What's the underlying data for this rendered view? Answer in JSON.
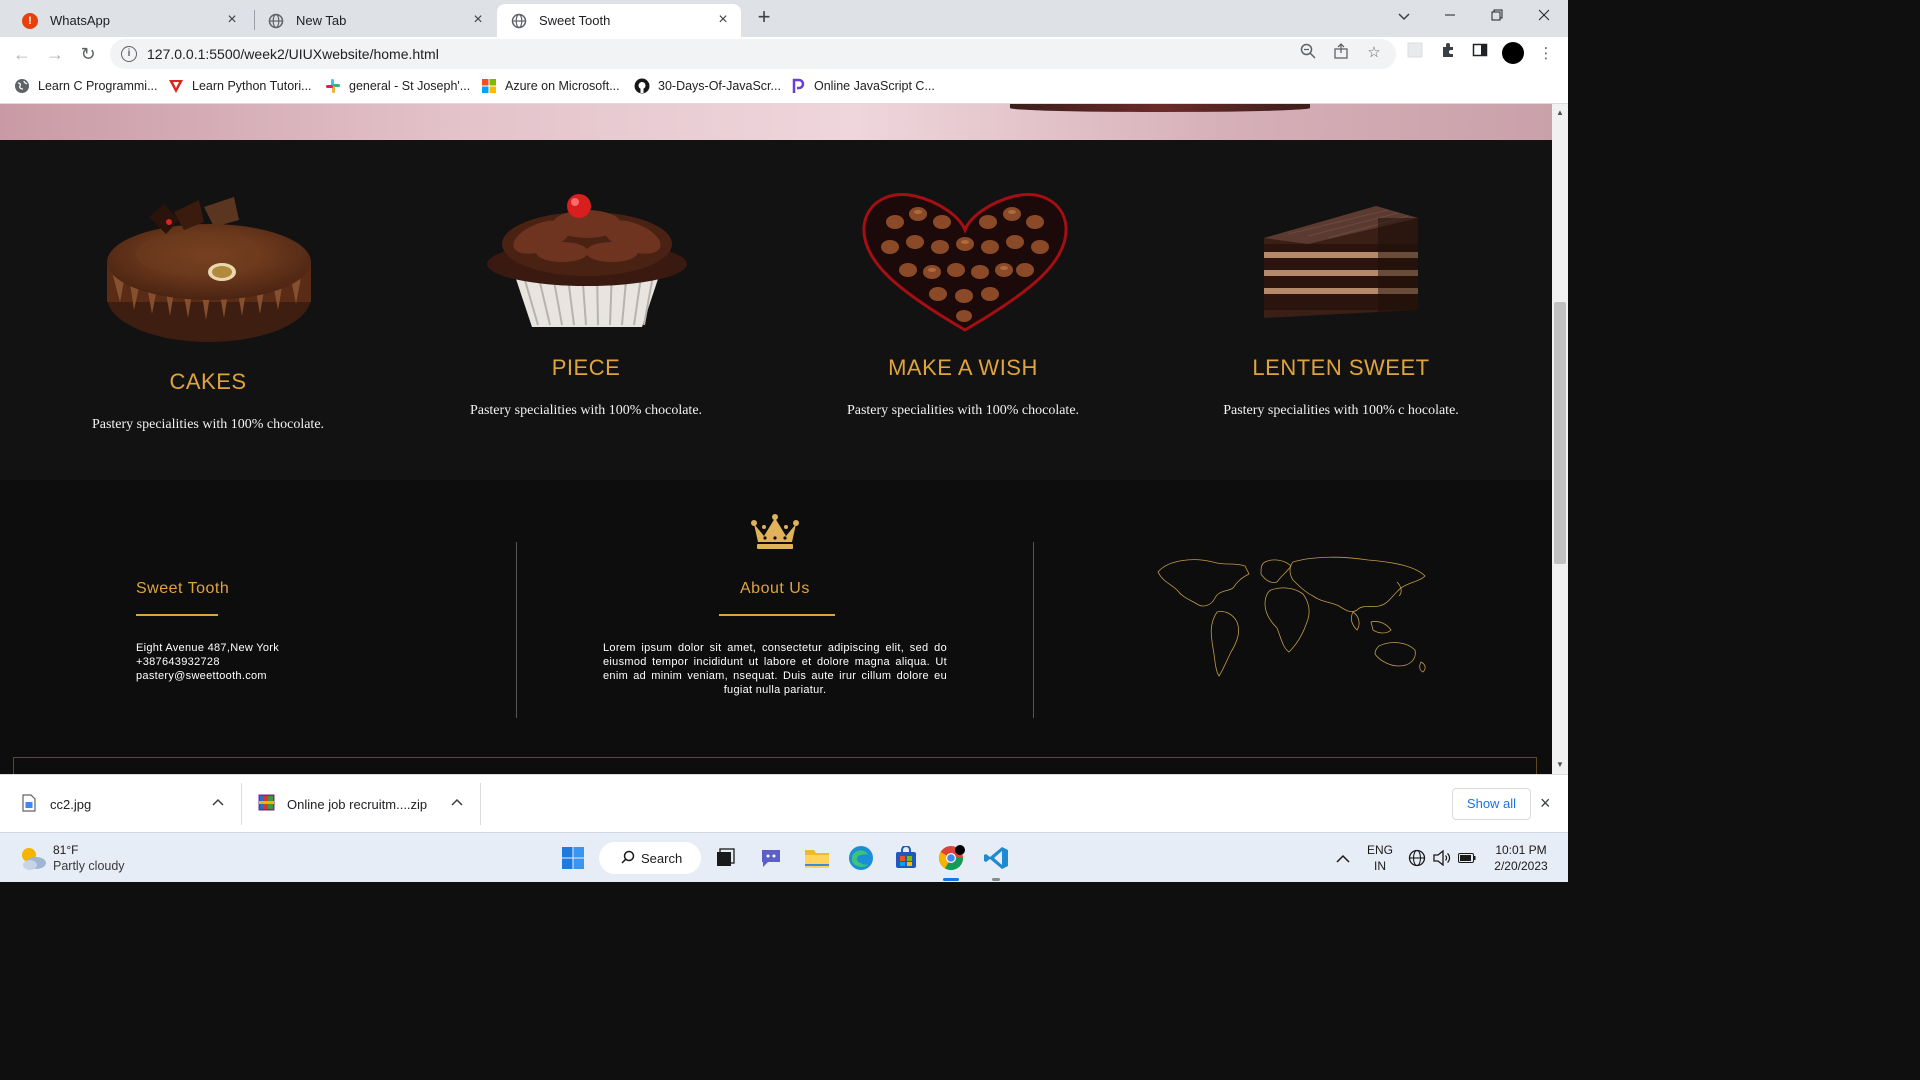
{
  "browser": {
    "tabs": [
      {
        "label": "WhatsApp",
        "icon": "whatsapp-alert-icon"
      },
      {
        "label": "New Tab",
        "icon": "globe-icon"
      },
      {
        "label": "Sweet Tooth",
        "icon": "globe-icon",
        "active": true
      }
    ],
    "url": "127.0.0.1:5500/week2/UIUXwebsite/home.html",
    "bookmarks": [
      {
        "label": "Learn C Programmi...",
        "icon": "globe-icon"
      },
      {
        "label": "Learn Python Tutori...",
        "icon": "tutorials-point-icon"
      },
      {
        "label": "general - St Joseph'...",
        "icon": "slack-icon"
      },
      {
        "label": "Azure on Microsoft...",
        "icon": "microsoft-icon"
      },
      {
        "label": "30-Days-Of-JavaScr...",
        "icon": "github-icon"
      },
      {
        "label": "Online JavaScript C...",
        "icon": "programiz-icon"
      }
    ]
  },
  "products": [
    {
      "title": "CAKES",
      "desc": "Pastery specialities with 100% chocolate."
    },
    {
      "title": "PIECE",
      "desc": "Pastery specialities with 100% chocolate."
    },
    {
      "title": "MAKE A WISH",
      "desc": "Pastery specialities with 100% chocolate."
    },
    {
      "title": "LENTEN SWEET",
      "desc": "Pastery specialities with 100% c hocolate."
    }
  ],
  "footer": {
    "brand": {
      "title": "Sweet Tooth",
      "address": "Eight Avenue 487,New York",
      "phone": "+387643932728",
      "email": "pastery@sweettooth.com"
    },
    "about": {
      "title": "About Us",
      "text": "Lorem ipsum dolor sit amet, consectetur adipiscing elit, sed do eiusmod tempor incididunt ut labore et dolore magna aliqua. Ut enim ad minim veniam, nsequat. Duis aute irur cillum dolore eu fugiat nulla pariatur."
    }
  },
  "downloads": {
    "items": [
      {
        "name": "cc2.jpg"
      },
      {
        "name": "Online job recruitm....zip"
      }
    ],
    "show_all": "Show all"
  },
  "taskbar": {
    "weather_temp": "81°F",
    "weather_desc": "Partly cloudy",
    "search_label": "Search",
    "lang_1": "ENG",
    "lang_2": "IN",
    "time": "10:01 PM",
    "date": "2/20/2023"
  },
  "colors": {
    "accent_gold": "#e0a43c",
    "page_dark": "#121212",
    "footer_dark": "#0d0d0d"
  }
}
